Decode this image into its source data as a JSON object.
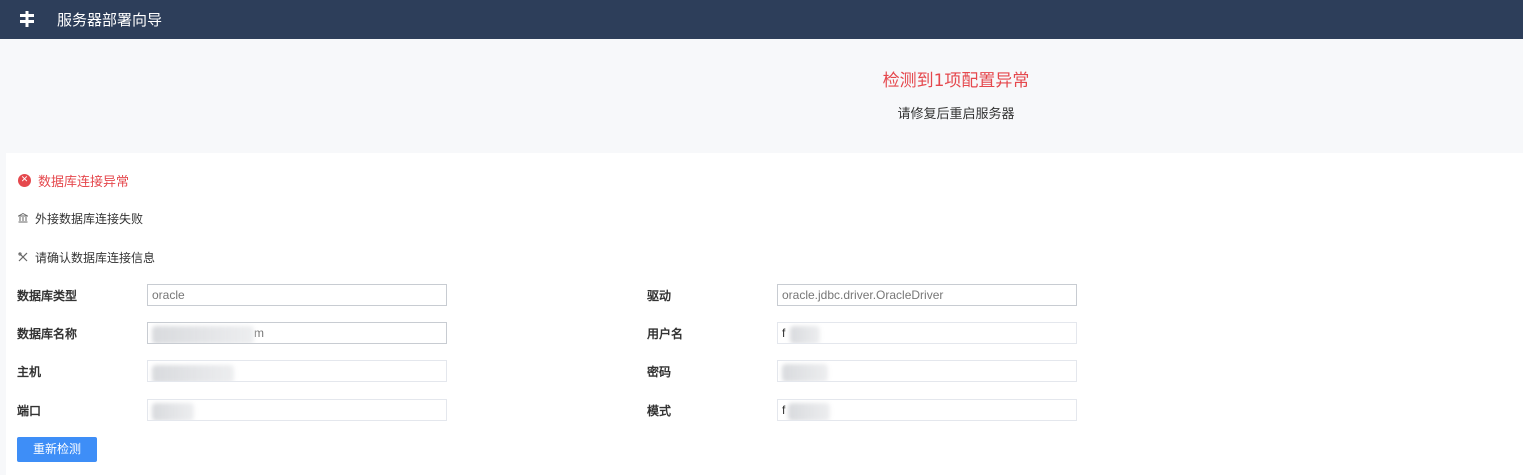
{
  "header": {
    "title": "服务器部署向导",
    "logo_icon": "wizard-logo-icon"
  },
  "summary": {
    "title": "检测到1项配置异常",
    "subtitle": "请修复后重启服务器",
    "accent": "#e5484d"
  },
  "error": {
    "title": "数据库连接异常",
    "message": "外接数据库连接失败",
    "hint": "请确认数据库连接信息"
  },
  "form": {
    "db_type": {
      "label": "数据库类型",
      "value": "oracle"
    },
    "db_name": {
      "label": "数据库名称",
      "value": "m"
    },
    "host": {
      "label": "主机",
      "value": ""
    },
    "port": {
      "label": "端口",
      "value": ""
    },
    "driver": {
      "label": "驱动",
      "value": "oracle.jdbc.driver.OracleDriver"
    },
    "username": {
      "label": "用户名",
      "value": "f"
    },
    "password": {
      "label": "密码",
      "value": ""
    },
    "schema": {
      "label": "模式",
      "value": "f"
    }
  },
  "actions": {
    "recheck_label": "重新检测",
    "button_color": "#3e8ef7"
  },
  "colors": {
    "topbar": "#2d3e5a",
    "hero_bg": "#f7f8fa"
  }
}
